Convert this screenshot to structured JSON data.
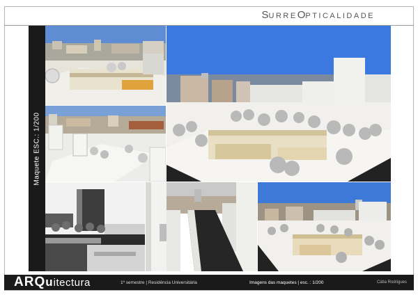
{
  "header": {
    "title_s": "S",
    "title_1": "URRE",
    "title_o": "O",
    "title_2": "PTICALIDADE"
  },
  "sidebar": {
    "label": "Maquete ESC.: 1/200"
  },
  "footer": {
    "brand_main": "ARQ",
    "brand_q": "u",
    "brand_rest": "itectura",
    "meta": "1º semestre | Residência Universitária",
    "caption": "Imagens das maquetes | esc. : 1/200",
    "author": "Cátia Rodrigues"
  },
  "photos": [
    {
      "name": "photo-top-left-aerial",
      "sky": "#5f8dd4"
    },
    {
      "name": "photo-mid-left-aerial",
      "sky": "#7aa0d8"
    },
    {
      "name": "photo-large-main",
      "sky": "#3b78e0"
    },
    {
      "name": "photo-bw-left",
      "sky": "#f2f2f2"
    },
    {
      "name": "photo-street-corridor",
      "sky": "#c9c9c9"
    },
    {
      "name": "photo-bottom-right",
      "sky": "#3d7ad8"
    }
  ]
}
